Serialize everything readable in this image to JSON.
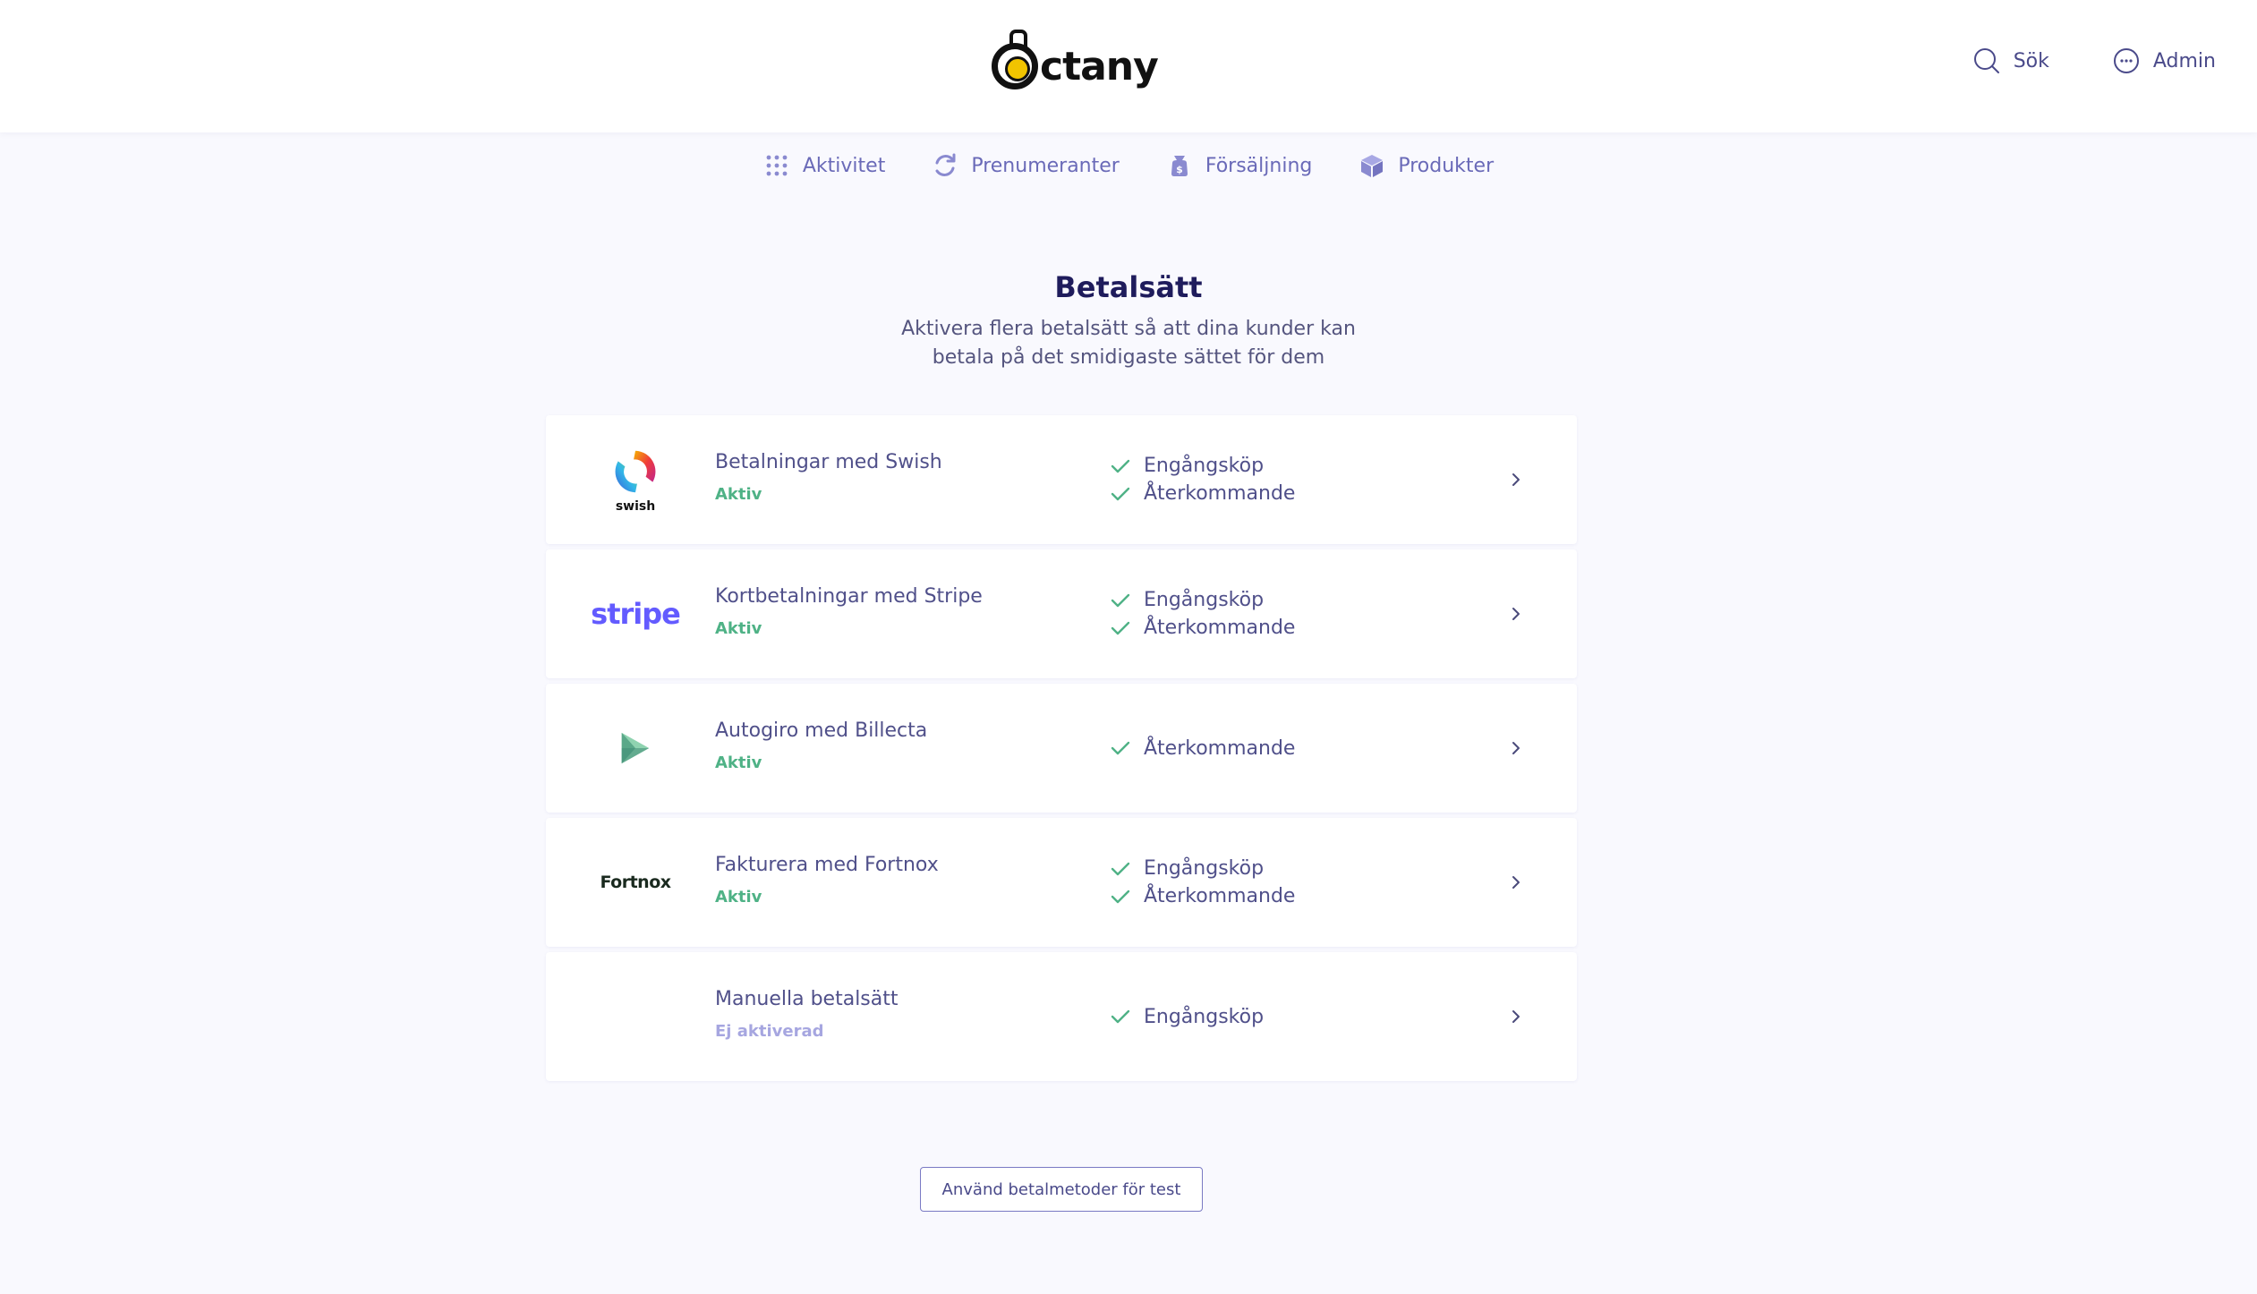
{
  "brand": {
    "name": "ctany"
  },
  "header": {
    "search_label": "Sök",
    "admin_label": "Admin"
  },
  "nav": {
    "items": [
      {
        "label": "Aktivitet",
        "icon": "grid-dots-icon"
      },
      {
        "label": "Prenumeranter",
        "icon": "refresh-icon"
      },
      {
        "label": "Försäljning",
        "icon": "money-bag-icon"
      },
      {
        "label": "Produkter",
        "icon": "box-icon"
      }
    ]
  },
  "page": {
    "title": "Betalsätt",
    "subtitle_line1": "Aktivera flera betalsätt så att dina kunder kan",
    "subtitle_line2": "betala på det smidigaste sättet för dem"
  },
  "payment_methods": [
    {
      "name": "Betalningar med Swish",
      "status": "Aktiv",
      "logo": "swish-logo",
      "logo_text": "swish",
      "features": [
        "Engångsköp",
        "Återkommande"
      ]
    },
    {
      "name": "Kortbetalningar med Stripe",
      "status": "Aktiv",
      "logo": "stripe-logo",
      "logo_text": "stripe",
      "features": [
        "Engångsköp",
        "Återkommande"
      ]
    },
    {
      "name": "Autogiro med Billecta",
      "status": "Aktiv",
      "logo": "billecta-logo",
      "features": [
        "Återkommande"
      ]
    },
    {
      "name": "Fakturera med Fortnox",
      "status": "Aktiv",
      "logo": "fortnox-logo",
      "logo_text": "Fortnox",
      "features": [
        "Engångsköp",
        "Återkommande"
      ]
    },
    {
      "name": "Manuella betalsätt",
      "status": "Ej aktiverad",
      "logo": "none",
      "features": [
        "Engångsköp"
      ]
    }
  ],
  "test_button_label": "Använd betalmetoder för test",
  "colors": {
    "accent": "#6a6ab8",
    "title": "#1f1c5c",
    "active_green": "#4fb286",
    "inactive": "#a6a6e0",
    "stripe": "#635bff"
  }
}
